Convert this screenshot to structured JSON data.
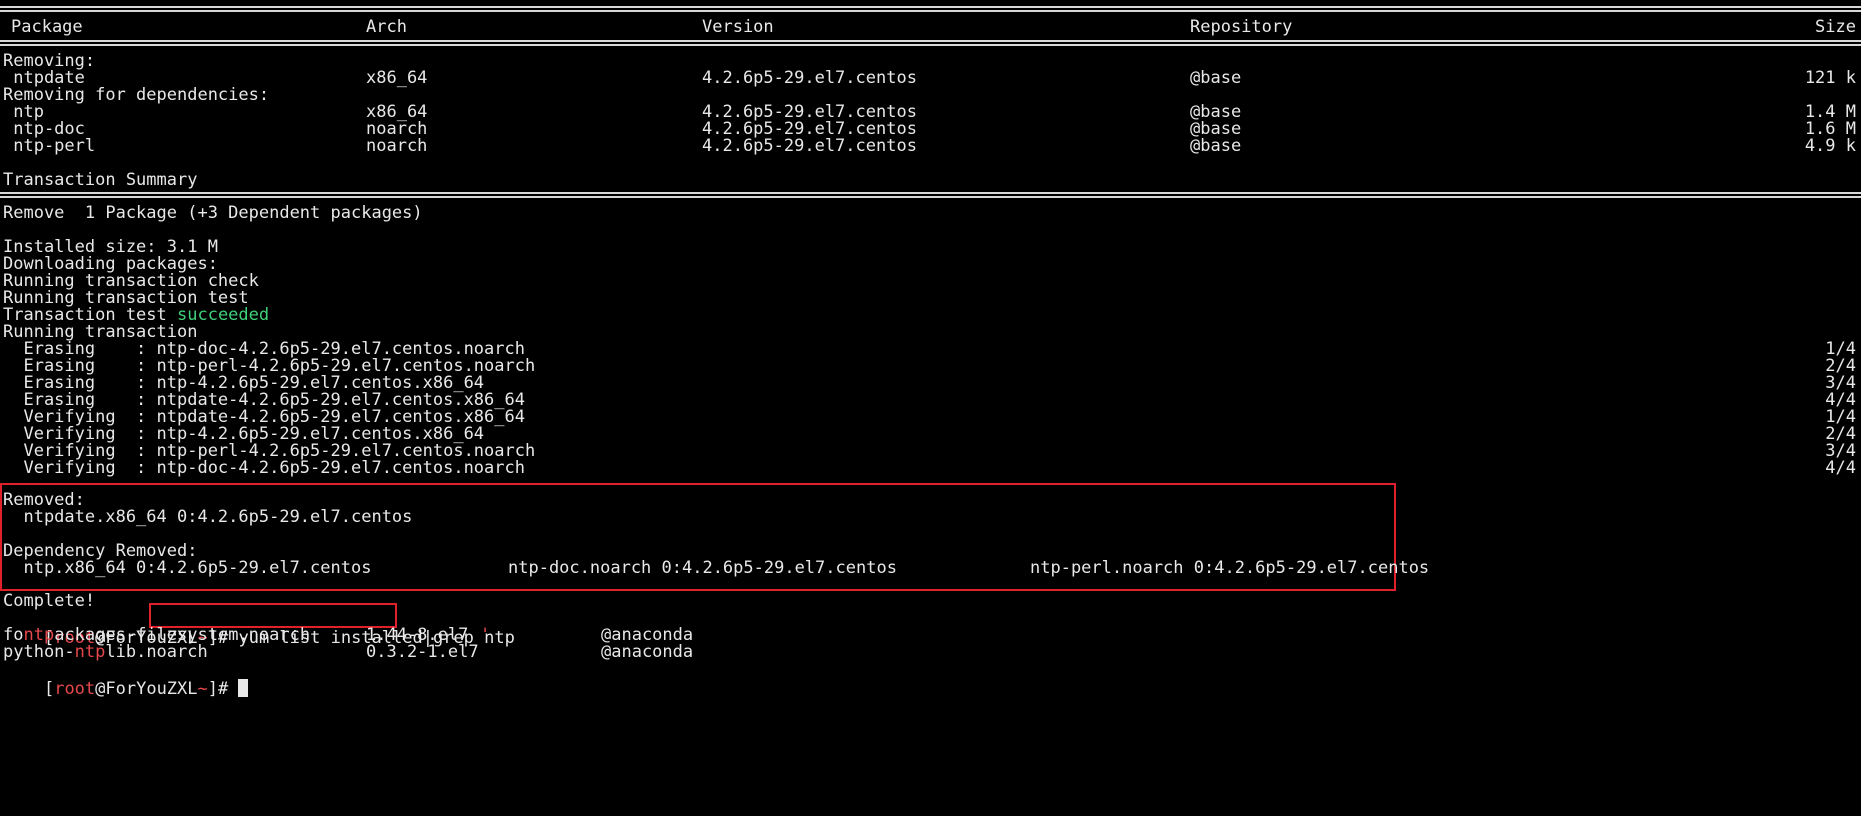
{
  "header": {
    "package": "Package",
    "arch": "Arch",
    "version": "Version",
    "repository": "Repository",
    "size": "Size"
  },
  "removing": {
    "label": "Removing:",
    "rows": [
      {
        "name": " ntpdate",
        "arch": "x86_64",
        "version": "4.2.6p5-29.el7.centos",
        "repo": "@base",
        "size": "121 k"
      }
    ]
  },
  "deps": {
    "label": "Removing for dependencies:",
    "rows": [
      {
        "name": " ntp",
        "arch": "x86_64",
        "version": "4.2.6p5-29.el7.centos",
        "repo": "@base",
        "size": "1.4 M"
      },
      {
        "name": " ntp-doc",
        "arch": "noarch",
        "version": "4.2.6p5-29.el7.centos",
        "repo": "@base",
        "size": "1.6 M"
      },
      {
        "name": " ntp-perl",
        "arch": "noarch",
        "version": "4.2.6p5-29.el7.centos",
        "repo": "@base",
        "size": "4.9 k"
      }
    ]
  },
  "summary": {
    "title": "Transaction Summary",
    "remove": "Remove  1 Package (+3 Dependent packages)"
  },
  "log": {
    "installed_size": "Installed size: 3.1 M",
    "downloading": "Downloading packages:",
    "check": "Running transaction check",
    "test": "Running transaction test",
    "test_result_prefix": "Transaction test ",
    "test_result_status": "succeeded",
    "running": "Running transaction"
  },
  "steps": [
    {
      "action": "  Erasing    : ntp-doc-4.2.6p5-29.el7.centos.noarch",
      "count": "1/4"
    },
    {
      "action": "  Erasing    : ntp-perl-4.2.6p5-29.el7.centos.noarch",
      "count": "2/4"
    },
    {
      "action": "  Erasing    : ntp-4.2.6p5-29.el7.centos.x86_64",
      "count": "3/4"
    },
    {
      "action": "  Erasing    : ntpdate-4.2.6p5-29.el7.centos.x86_64",
      "count": "4/4"
    },
    {
      "action": "  Verifying  : ntpdate-4.2.6p5-29.el7.centos.x86_64",
      "count": "1/4"
    },
    {
      "action": "  Verifying  : ntp-4.2.6p5-29.el7.centos.x86_64",
      "count": "2/4"
    },
    {
      "action": "  Verifying  : ntp-perl-4.2.6p5-29.el7.centos.noarch",
      "count": "3/4"
    },
    {
      "action": "  Verifying  : ntp-doc-4.2.6p5-29.el7.centos.noarch",
      "count": "4/4"
    }
  ],
  "removed": {
    "label": "Removed:",
    "item": "  ntpdate.x86_64 0:4.2.6p5-29.el7.centos",
    "dep_label": "Dependency Removed:",
    "dep_items": [
      "  ntp.x86_64 0:4.2.6p5-29.el7.centos",
      "ntp-doc.noarch 0:4.2.6p5-29.el7.centos",
      "ntp-perl.noarch 0:4.2.6p5-29.el7.centos"
    ]
  },
  "complete": "Complete!",
  "prompt": {
    "open": "[",
    "user": "root",
    "host": "@ForYouZXL",
    "path": "~",
    "close": "]# ",
    "command": "yum list installed|grep ntp"
  },
  "results": [
    {
      "pre": "fo",
      "match": "ntp",
      "post": "ackages-filesystem.noarch",
      "version": "1.44-8.el7",
      "quote": "'",
      "repo": "@anaconda"
    },
    {
      "pre": "python-",
      "match": "ntp",
      "post": "lib.noarch",
      "version": "0.3.2-1.el7",
      "quote": "",
      "repo": "@anaconda"
    }
  ],
  "colors": {
    "accent": "#e5484d",
    "success": "#3fd07a",
    "highlight_box": "#e0202a"
  }
}
